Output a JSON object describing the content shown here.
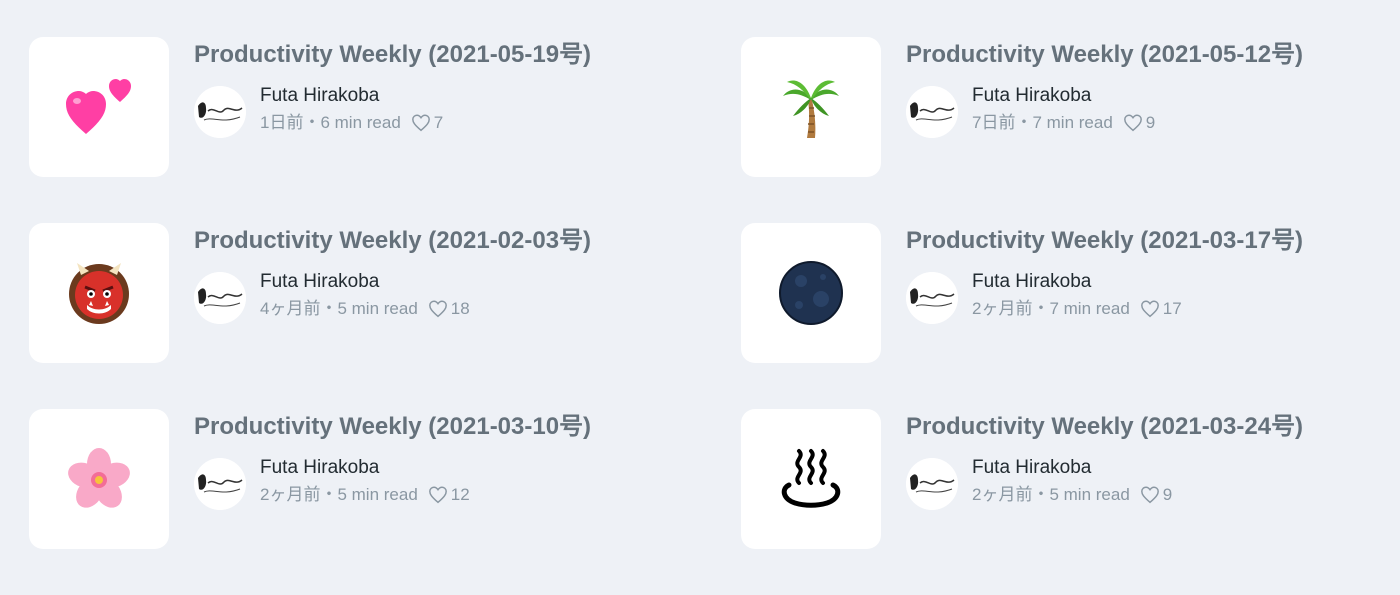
{
  "articles": [
    {
      "title": "Productivity Weekly (2021-05-19号)",
      "author": "Futa Hirakoba",
      "date": "1日前",
      "read_time": "6 min read",
      "likes": "7",
      "emoji": "two-hearts-icon"
    },
    {
      "title": "Productivity Weekly (2021-05-12号)",
      "author": "Futa Hirakoba",
      "date": "7日前",
      "read_time": "7 min read",
      "likes": "9",
      "emoji": "palm-tree-icon"
    },
    {
      "title": "Productivity Weekly (2021-02-03号)",
      "author": "Futa Hirakoba",
      "date": "4ヶ月前",
      "read_time": "5 min read",
      "likes": "18",
      "emoji": "ogre-icon"
    },
    {
      "title": "Productivity Weekly (2021-03-17号)",
      "author": "Futa Hirakoba",
      "date": "2ヶ月前",
      "read_time": "7 min read",
      "likes": "17",
      "emoji": "new-moon-icon"
    },
    {
      "title": "Productivity Weekly (2021-03-10号)",
      "author": "Futa Hirakoba",
      "date": "2ヶ月前",
      "read_time": "5 min read",
      "likes": "12",
      "emoji": "cherry-blossom-icon"
    },
    {
      "title": "Productivity Weekly (2021-03-24号)",
      "author": "Futa Hirakoba",
      "date": "2ヶ月前",
      "read_time": "5 min read",
      "likes": "9",
      "emoji": "hot-springs-icon"
    }
  ],
  "separator": "・",
  "colors": {
    "background": "#eef1f6",
    "title": "#65717b",
    "meta": "#8a97a2",
    "author": "#222b31"
  }
}
